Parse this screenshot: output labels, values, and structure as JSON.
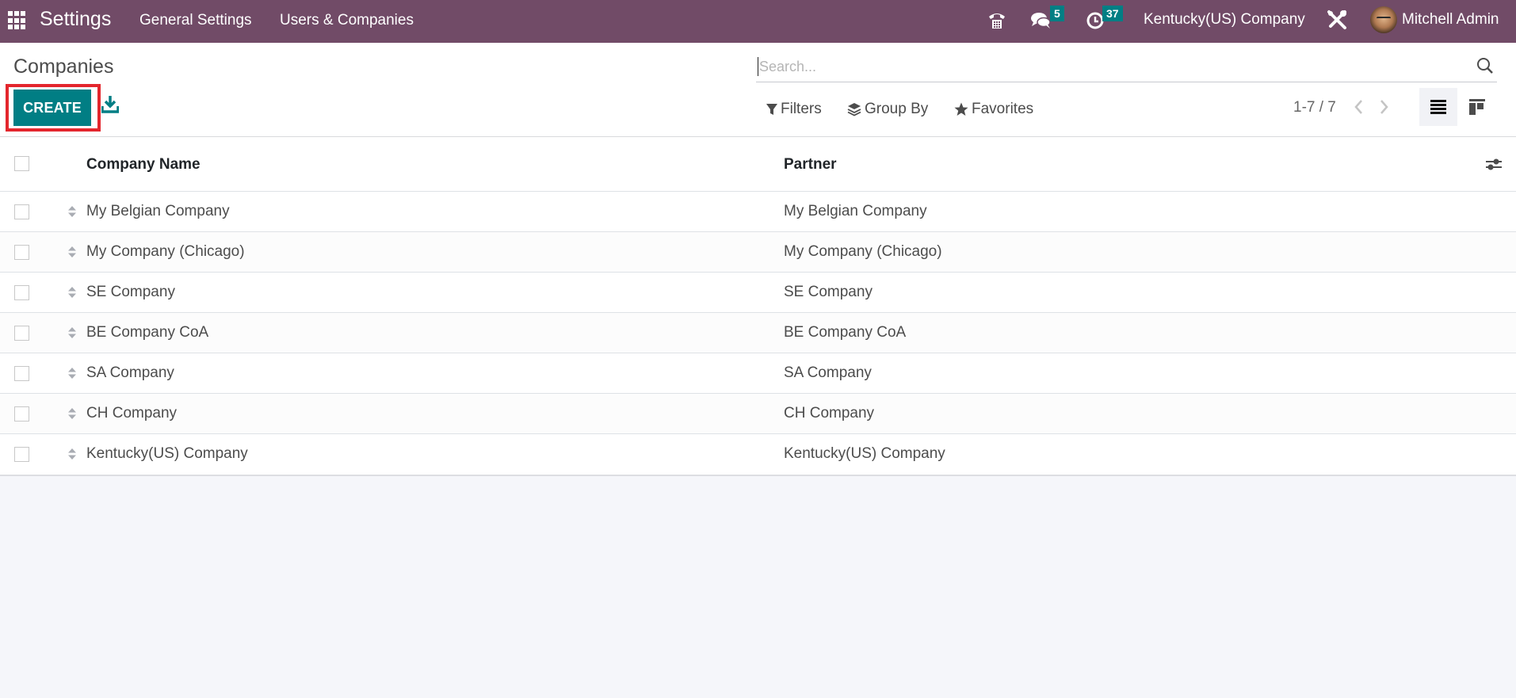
{
  "navbar": {
    "app_title": "Settings",
    "menu": [
      "General Settings",
      "Users & Companies"
    ],
    "messages_badge": "5",
    "activities_badge": "37",
    "company": "Kentucky(US) Company",
    "user": "Mitchell Admin",
    "icons": {
      "apps": "apps-grid-icon",
      "phone": "voip-phone-icon",
      "messages": "chat-bubbles-icon",
      "activities": "clock-icon",
      "debug": "tools-icon"
    }
  },
  "control_panel": {
    "title": "Companies",
    "create_label": "CREATE",
    "search_placeholder": "Search...",
    "search_value": "",
    "filters_label": "Filters",
    "groupby_label": "Group By",
    "favorites_label": "Favorites",
    "pager": "1-7 / 7",
    "active_view": "list"
  },
  "table": {
    "columns": [
      "Company Name",
      "Partner"
    ],
    "rows": [
      {
        "company": "My Belgian Company",
        "partner": "My Belgian Company"
      },
      {
        "company": "My Company (Chicago)",
        "partner": "My Company (Chicago)"
      },
      {
        "company": "SE Company",
        "partner": "SE Company"
      },
      {
        "company": "BE Company CoA",
        "partner": "BE Company CoA"
      },
      {
        "company": "SA Company",
        "partner": "SA Company"
      },
      {
        "company": "CH Company",
        "partner": "CH Company"
      },
      {
        "company": "Kentucky(US) Company",
        "partner": "Kentucky(US) Company"
      }
    ]
  },
  "colors": {
    "navbar": "#714b67",
    "primary": "#017e84",
    "highlight": "#e3262d"
  }
}
